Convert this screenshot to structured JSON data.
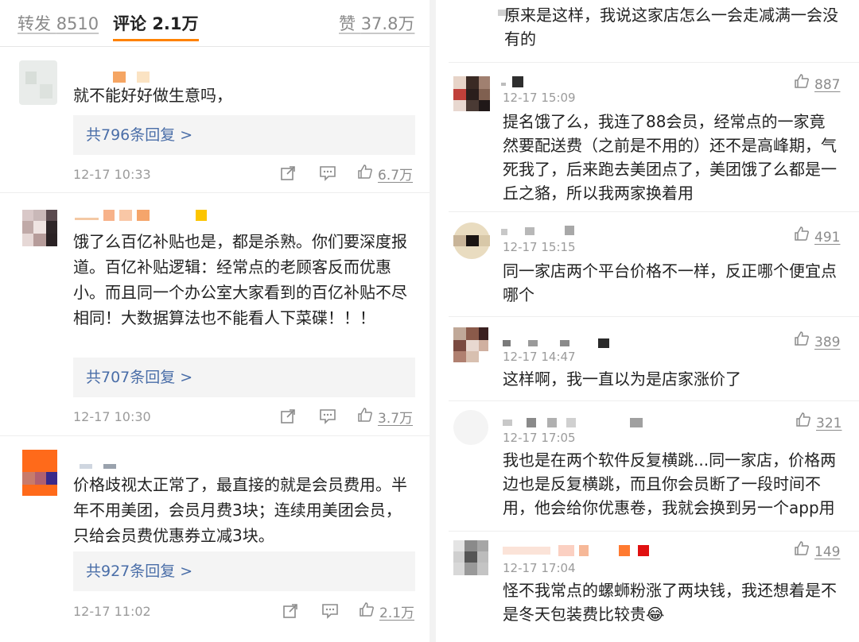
{
  "tabs": {
    "repost": {
      "label": "转发",
      "count": "8510"
    },
    "comment": {
      "label": "评论",
      "count": "2.1万"
    },
    "like": {
      "label": "赞",
      "count": "37.8万"
    }
  },
  "left_comments": [
    {
      "text": "就不能好好做生意吗，",
      "replies": "共796条回复 >",
      "time": "12-17 10:33",
      "likes": "6.7万"
    },
    {
      "text": "饿了么百亿补贴也是，都是杀熟。你们要深度报道。百亿补贴逻辑：经常点的老顾客反而优惠小。而且同一个办公室大家看到的百亿补贴不尽相同！大数据算法也不能看人下菜碟！！！",
      "replies": "共707条回复 >",
      "time": "12-17 10:30",
      "likes": "3.7万"
    },
    {
      "text": "价格歧视太正常了，最直接的就是会员费用。半年不用美团，会员月费3块；连续用美团会员，只给会员费优惠券立减3块。",
      "replies": "共927条回复 >",
      "time": "12-17 11:02",
      "likes": "2.1万"
    }
  ],
  "right_comments": [
    {
      "text": "原来是这样，我说这家店怎么一会走减满一会没有的",
      "time": "",
      "likes": ""
    },
    {
      "text": "提名饿了么，我连了88会员，经常点的一家竟然要配送费（之前是不用的）还不是高峰期，气死我了，后来跑去美团点了，美团饿了么都是一丘之貉，所以我两家换着用",
      "time": "12-17 15:09",
      "likes": "887"
    },
    {
      "text": "同一家店两个平台价格不一样，反正哪个便宜点哪个",
      "time": "12-17 15:15",
      "likes": "491"
    },
    {
      "text": "这样啊，我一直以为是店家涨价了",
      "time": "12-17 14:47",
      "likes": "389"
    },
    {
      "text": "我也是在两个软件反复横跳...同一家店，价格两边也是反复横跳，而且你会员断了一段时间不用，他会给你优惠卷，我就会换到另一个app用",
      "time": "12-17 17:05",
      "likes": "321"
    },
    {
      "text": "怪不我常点的螺蛳粉涨了两块钱，我还想着是不是冬天包装费比较贵😂",
      "time": "12-17 17:04",
      "likes": "149"
    }
  ],
  "icons": {
    "share": "share-icon",
    "comment": "comment-icon",
    "like": "thumbs-up-icon"
  },
  "colors": {
    "accent": "#ff8200",
    "reply_link": "#4a6ea8",
    "muted": "#9b9b9b"
  }
}
